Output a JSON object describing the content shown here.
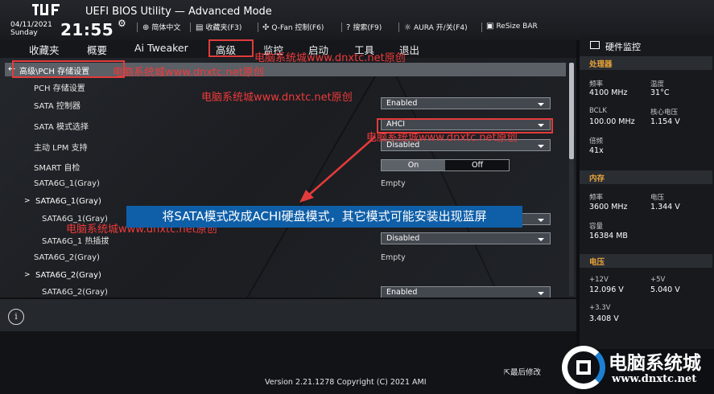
{
  "header": {
    "title": "UEFI BIOS Utility — Advanced Mode",
    "date": "04/11/2021",
    "day": "Sunday",
    "time": "21:55",
    "toolbar": [
      {
        "icon": "globe-icon",
        "label": "简体中文"
      },
      {
        "icon": "bookmark-icon",
        "label": "收藏夹(F3)"
      },
      {
        "icon": "fan-icon",
        "label": "Q-Fan 控制(F6)"
      },
      {
        "icon": "help-icon",
        "label": "搜索(F9)"
      },
      {
        "icon": "aura-icon",
        "label": "AURA 开/关(F4)"
      },
      {
        "icon": "resize-bar-icon",
        "label": "ReSize BAR"
      }
    ]
  },
  "tabs": [
    {
      "label": "收藏夹",
      "active": false
    },
    {
      "label": "概要",
      "active": false
    },
    {
      "label": "Ai Tweaker",
      "active": false
    },
    {
      "label": "高级",
      "active": true
    },
    {
      "label": "监控",
      "active": false
    },
    {
      "label": "启动",
      "active": false
    },
    {
      "label": "工具",
      "active": false
    },
    {
      "label": "退出",
      "active": false
    }
  ],
  "main": {
    "breadcrumb": "高级\\PCH 存储设置",
    "rows": [
      {
        "label": "PCH 存储设置",
        "type": "text"
      },
      {
        "label": "SATA 控制器",
        "type": "dropdown",
        "value": "Enabled"
      },
      {
        "label": "SATA 模式选择",
        "type": "dropdown",
        "value": "AHCI"
      },
      {
        "label": "主动 LPM 支持",
        "type": "dropdown",
        "value": "Disabled"
      },
      {
        "label": "SMART 自检",
        "type": "toggle",
        "on": "On",
        "off": "Off",
        "value": "On"
      },
      {
        "label": "SATA6G_1(Gray)",
        "type": "static",
        "value": "Empty"
      },
      {
        "label": "SATA6G_1(Gray)",
        "type": "submenu"
      },
      {
        "label": "SATA6G_1(Gray)",
        "type": "dropdown",
        "value": ""
      },
      {
        "label": "SATA6G_1 热插拔",
        "type": "dropdown",
        "value": "Disabled"
      },
      {
        "label": "SATA6G_2(Gray)",
        "type": "static",
        "value": "Empty"
      },
      {
        "label": "SATA6G_2(Gray)",
        "type": "submenu"
      },
      {
        "label": "SATA6G_2(Gray)",
        "type": "dropdown",
        "value": "Enabled"
      }
    ]
  },
  "footer": {
    "version": "Version 2.21.1278 Copyright (C) 2021 AMI",
    "last_modified": "最后修改"
  },
  "hardware_monitor": {
    "title": "硬件监控",
    "cpu": {
      "section": "处理器",
      "freq_label": "频率",
      "freq": "4100 MHz",
      "temp_label": "温度",
      "temp": "31°C",
      "bclk_label": "BCLK",
      "bclk": "100.00 MHz",
      "vcore_label": "核心电压",
      "vcore": "1.154 V",
      "ratio_label": "倍频",
      "ratio": "41x"
    },
    "memory": {
      "section": "内存",
      "freq_label": "频率",
      "freq": "3600 MHz",
      "volt_label": "电压",
      "volt": "1.344 V",
      "cap_label": "容量",
      "cap": "16384 MB"
    },
    "voltage": {
      "section": "电压",
      "v12_label": "+12V",
      "v12": "12.096 V",
      "v5_label": "+5V",
      "v5": "5.040 V",
      "v33_label": "+3.3V",
      "v33": "3.408 V"
    }
  },
  "annotations": {
    "watermark": "电脑系统城www.dnxtc.net原创",
    "banner": "将SATA模式改成ACHI硬盘模式，其它模式可能安装出现蓝屏",
    "accent_color": "#e23b3b",
    "banner_color": "#0f5fa8"
  },
  "badge": {
    "name": "电脑系统城",
    "url": "www.dnxtc.net"
  }
}
